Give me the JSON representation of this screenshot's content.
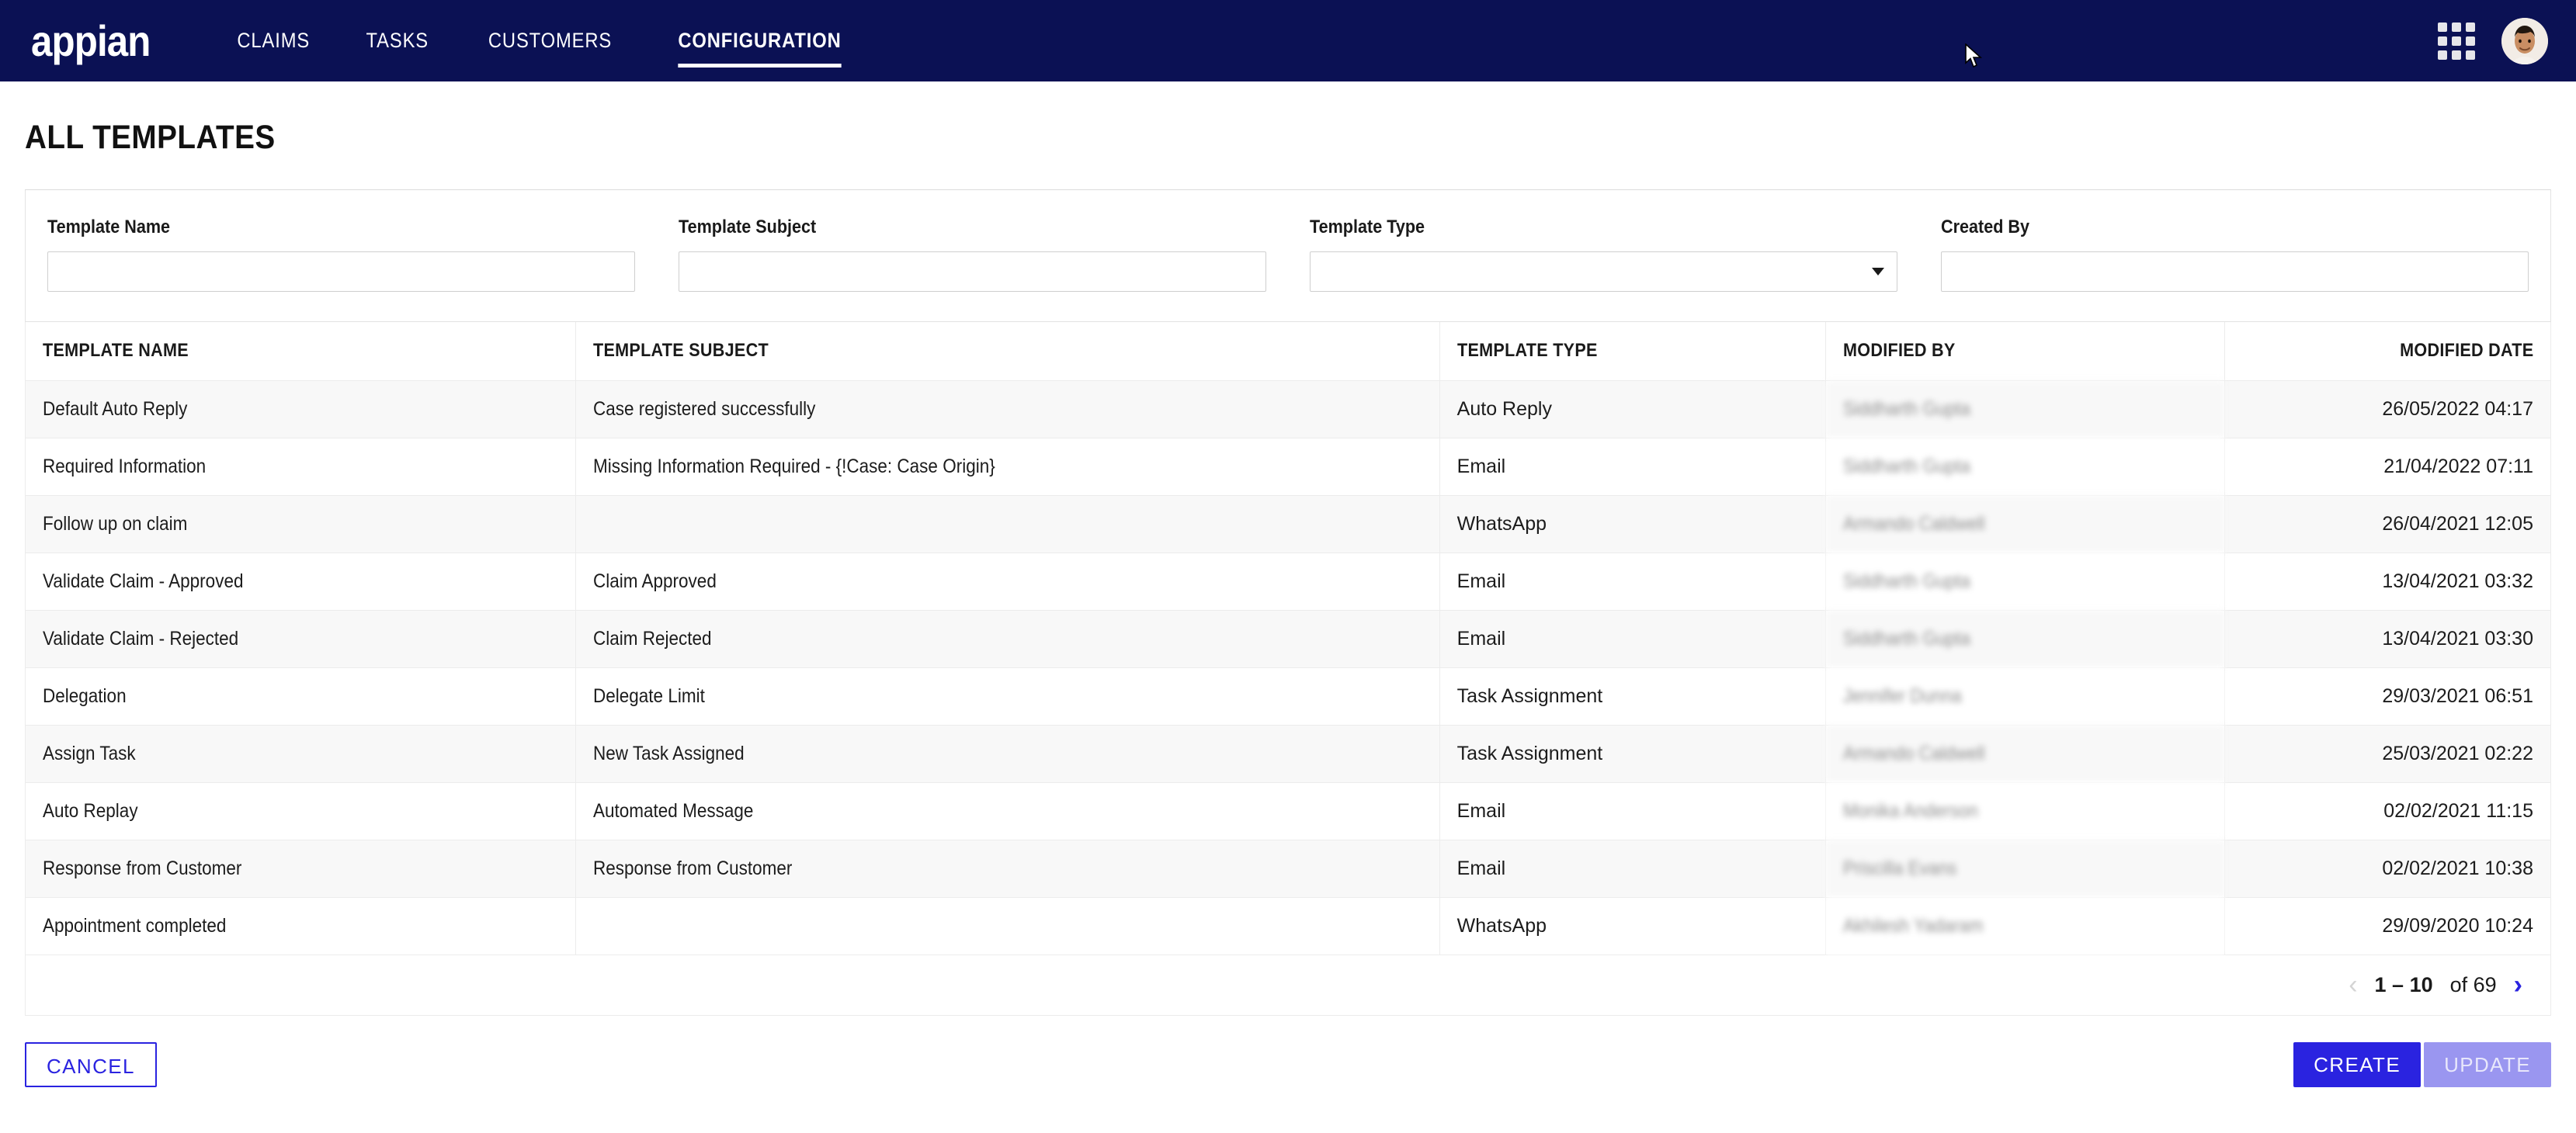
{
  "nav": {
    "logo_text": "appian",
    "links": [
      {
        "label": "CLAIMS",
        "active": false
      },
      {
        "label": "TASKS",
        "active": false
      },
      {
        "label": "CUSTOMERS",
        "active": false
      },
      {
        "label": "CONFIGURATION",
        "active": true
      }
    ],
    "app_grid_icon": "apps-grid-icon",
    "avatar_icon": "user-avatar"
  },
  "page": {
    "title": "ALL TEMPLATES"
  },
  "filters": [
    {
      "label": "Template Name",
      "value": "",
      "placeholder": "",
      "type": "text"
    },
    {
      "label": "Template Subject",
      "value": "",
      "placeholder": "",
      "type": "text"
    },
    {
      "label": "Template Type",
      "value": "",
      "placeholder": "",
      "type": "select"
    },
    {
      "label": "Created By",
      "value": "",
      "placeholder": "",
      "type": "text"
    }
  ],
  "table": {
    "columns": [
      "TEMPLATE NAME",
      "TEMPLATE SUBJECT",
      "TEMPLATE TYPE",
      "MODIFIED BY",
      "MODIFIED DATE"
    ],
    "rows": [
      {
        "name": "Default Auto Reply",
        "subject": "Case registered successfully",
        "type": "Auto Reply",
        "modified_by": "Siddharth Gupta",
        "modified_date": "26/05/2022 04:17"
      },
      {
        "name": "Required Information",
        "subject": "Missing Information Required - {!Case: Case Origin}",
        "type": "Email",
        "modified_by": "Siddharth Gupta",
        "modified_date": "21/04/2022 07:11"
      },
      {
        "name": "Follow up on claim",
        "subject": "",
        "type": "WhatsApp",
        "modified_by": "Armando Caldwell",
        "modified_date": "26/04/2021 12:05"
      },
      {
        "name": "Validate Claim - Approved",
        "subject": "Claim Approved",
        "type": "Email",
        "modified_by": "Siddharth Gupta",
        "modified_date": "13/04/2021 03:32"
      },
      {
        "name": "Validate Claim - Rejected",
        "subject": "Claim Rejected",
        "type": "Email",
        "modified_by": "Siddharth Gupta",
        "modified_date": "13/04/2021 03:30"
      },
      {
        "name": "Delegation",
        "subject": "Delegate Limit",
        "type": "Task Assignment",
        "modified_by": "Jennifer Dunna",
        "modified_date": "29/03/2021 06:51"
      },
      {
        "name": "Assign Task",
        "subject": "New Task Assigned",
        "type": "Task Assignment",
        "modified_by": "Armando Caldwell",
        "modified_date": "25/03/2021 02:22"
      },
      {
        "name": "Auto Replay",
        "subject": "Automated Message",
        "type": "Email",
        "modified_by": "Monika Anderson",
        "modified_date": "02/02/2021 11:15"
      },
      {
        "name": "Response from Customer",
        "subject": "Response from Customer",
        "type": "Email",
        "modified_by": "Priscilla Evans",
        "modified_date": "02/02/2021 10:38"
      },
      {
        "name": "Appointment completed",
        "subject": "",
        "type": "WhatsApp",
        "modified_by": "Akhilesh Yadaram",
        "modified_date": "29/09/2020 10:24"
      }
    ]
  },
  "pagination": {
    "prev_icon": "chevron-left-icon",
    "next_icon": "chevron-right-icon",
    "range": "1 – 10",
    "total": "of 69"
  },
  "footer": {
    "cancel_label": "CANCEL",
    "create_label": "CREATE",
    "update_label": "UPDATE"
  },
  "colors": {
    "nav_background": "#0B1154",
    "accent": "#2A23E0",
    "accent_disabled": "#9A96F0",
    "row_stripe": "#F8F8F8",
    "border": "#ECECEC"
  }
}
